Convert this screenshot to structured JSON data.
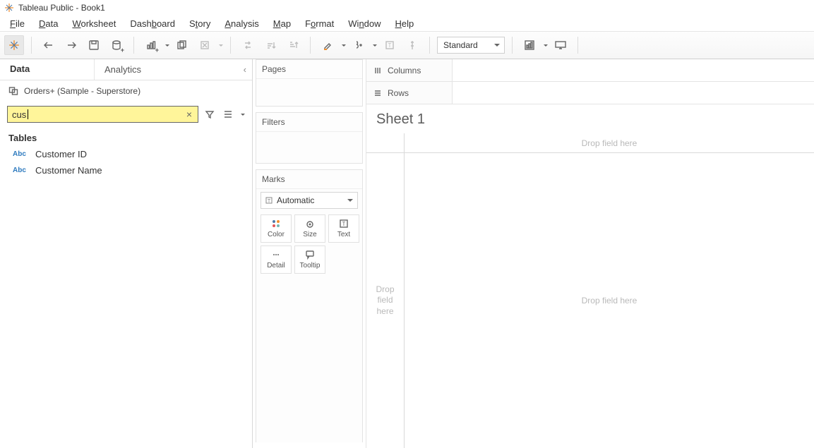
{
  "title": "Tableau Public - Book1",
  "menu": {
    "file": {
      "label": "File",
      "ul": "F"
    },
    "data": {
      "label": "Data",
      "ul": "D"
    },
    "worksheet": {
      "label": "Worksheet",
      "ul": "W"
    },
    "dashboard": {
      "label": "Dashboard",
      "ul": "b"
    },
    "story": {
      "label": "Story",
      "ul": "t"
    },
    "analysis": {
      "label": "Analysis",
      "ul": "A"
    },
    "map": {
      "label": "Map",
      "ul": "M"
    },
    "format": {
      "label": "Format",
      "ul": "o"
    },
    "window": {
      "label": "Window",
      "ul": "n"
    },
    "help": {
      "label": "Help",
      "ul": "H"
    }
  },
  "toolbar": {
    "fit_label": "Standard"
  },
  "datapane": {
    "tab_data": "Data",
    "tab_analytics": "Analytics",
    "source": "Orders+ (Sample - Superstore)",
    "search_value": "cus",
    "tables_header": "Tables",
    "fields": [
      {
        "type": "Abc",
        "name": "Customer ID"
      },
      {
        "type": "Abc",
        "name": "Customer Name"
      }
    ]
  },
  "cards": {
    "pages": "Pages",
    "filters": "Filters",
    "marks": "Marks",
    "marks_type": "Automatic",
    "mark_color": "Color",
    "mark_size": "Size",
    "mark_text": "Text",
    "mark_detail": "Detail",
    "mark_tooltip": "Tooltip"
  },
  "shelves": {
    "columns": "Columns",
    "rows": "Rows"
  },
  "sheet": {
    "title": "Sheet 1",
    "drop_field_here": "Drop field here",
    "drop_stack": "Drop\nfield\nhere"
  }
}
